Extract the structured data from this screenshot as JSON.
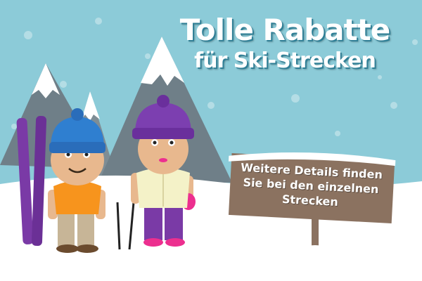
{
  "headline": {
    "line1": "Tolle Rabatte",
    "line2": "für Ski-Strecken"
  },
  "sign": {
    "text": "Weitere Details finden Sie bei den einzelnen Strecken"
  },
  "colors": {
    "sky": "#8ccbd8",
    "mountain": "#6f7f88",
    "snow": "#ffffff",
    "sign_wood": "#8b7260",
    "hat_blue": "#2f7fd0",
    "hat_purple": "#7c3fb0",
    "shirt_orange": "#f7941d",
    "pants_purple": "#7a3aa6",
    "skis_purple": "#7a3aa6"
  }
}
